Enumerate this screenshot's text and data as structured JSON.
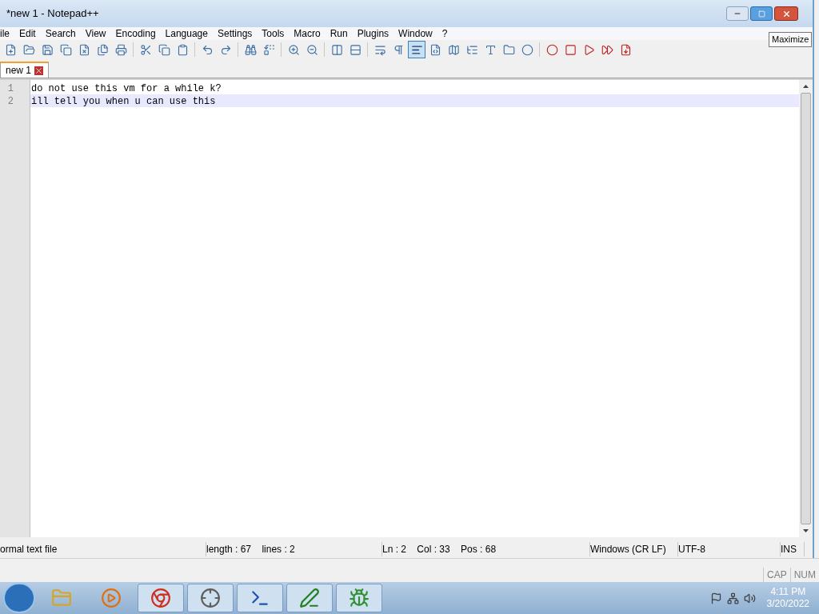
{
  "window": {
    "title": "*new 1 - Notepad++",
    "tooltip": "Maximize"
  },
  "menu": [
    "ile",
    "Edit",
    "Search",
    "View",
    "Encoding",
    "Language",
    "Settings",
    "Tools",
    "Macro",
    "Run",
    "Plugins",
    "Window",
    "?"
  ],
  "toolbar_buttons": [
    {
      "pressed": false
    },
    {
      "pressed": false
    },
    {
      "pressed": false
    },
    {
      "pressed": false
    },
    {
      "pressed": false
    },
    {
      "pressed": false
    },
    {
      "pressed": false
    },
    {
      "pressed": false
    },
    {
      "pressed": false
    },
    {
      "pressed": false
    },
    {
      "pressed": false
    },
    {
      "pressed": false
    },
    {
      "pressed": false
    },
    {
      "pressed": false
    },
    {
      "pressed": false
    },
    {
      "pressed": false
    },
    {
      "pressed": false
    },
    {
      "pressed": false
    },
    {
      "pressed": false
    },
    {
      "pressed": false
    },
    {
      "pressed": true
    },
    {
      "pressed": false
    },
    {
      "pressed": false
    },
    {
      "pressed": false
    },
    {
      "pressed": false
    },
    {
      "pressed": false
    },
    {
      "pressed": false
    },
    {
      "pressed": false
    },
    {
      "pressed": false
    },
    {
      "pressed": false
    },
    {
      "pressed": false
    },
    {
      "pressed": false
    }
  ],
  "tabs": [
    {
      "label": "new 1",
      "selected": true
    }
  ],
  "editor": {
    "lines": [
      {
        "number": "1",
        "text": "do not use this vm for a while k?",
        "current": false
      },
      {
        "number": "2",
        "text": "ill tell you when u can use this",
        "current": true
      }
    ]
  },
  "status_bar": [
    "ormal text file",
    "length : 67    lines : 2",
    "Ln : 2    Col : 33    Pos : 68",
    "Windows (CR LF)",
    "UTF-8",
    "INS"
  ],
  "indicators": [
    "CAP",
    "NUM"
  ],
  "taskbar": {
    "time": "4:11 PM",
    "date": "3/20/2022"
  }
}
